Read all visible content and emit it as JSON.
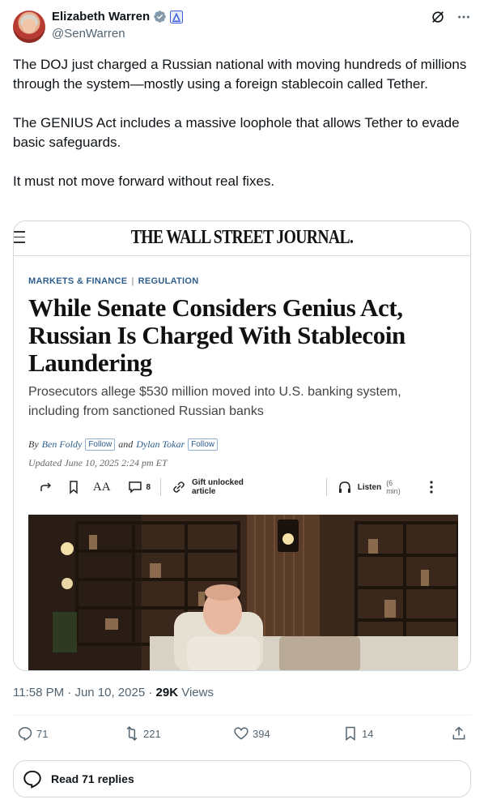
{
  "author": {
    "name": "Elizabeth Warren",
    "handle": "@SenWarren"
  },
  "tweet": {
    "paragraphs": [
      "The DOJ just charged a Russian national with moving hundreds of millions through the system—mostly using a foreign stablecoin called Tether.",
      "The GENIUS Act includes a massive loophole that allows Tether to evade basic safeguards.",
      "It must not move forward without real fixes."
    ]
  },
  "article": {
    "publication": "THE WALL STREET JOURNAL.",
    "section": "MARKETS & FINANCE",
    "section_sep": "|",
    "subsection": "REGULATION",
    "headline": "While Senate Considers Genius Act, Russian Is Charged With Stablecoin Laundering",
    "dek": "Prosecutors allege $530 million moved into U.S. banking system, including from sanctioned Russian banks",
    "by_label": "By",
    "author1": "Ben Foldy",
    "and_label": "and",
    "author2": "Dylan Tokar",
    "follow_label": "Follow",
    "updated": "Updated June 10, 2025 2:24 pm ET",
    "text_size_label": "AA",
    "comment_count": "8",
    "gift_label": "Gift unlocked article",
    "listen_label": "Listen",
    "listen_duration": "(6 min)"
  },
  "meta": {
    "time": "11:58 PM",
    "date": "Jun 10, 2025",
    "dot": "·",
    "views_count": "29K",
    "views_label": "Views"
  },
  "stats": {
    "replies": "71",
    "reposts": "221",
    "likes": "394",
    "bookmarks": "14"
  },
  "read_replies_label": "Read 71 replies",
  "colors": {
    "verified": "#1d9bf0",
    "wsj_link": "#2e5e8c",
    "muted": "#536471"
  }
}
